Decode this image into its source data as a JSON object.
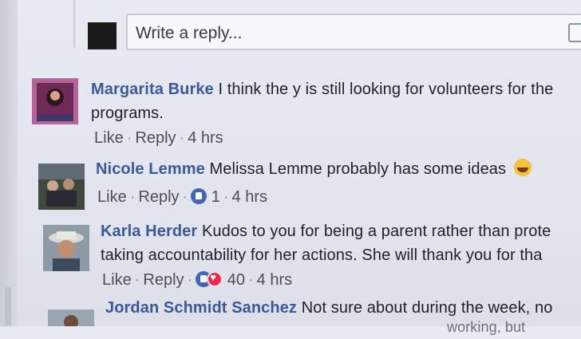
{
  "reply_box": {
    "placeholder": "Write a reply..."
  },
  "comments": [
    {
      "author": "Margarita Burke",
      "text_line1": "I think the y is still looking for volunteers for the",
      "text_line2": "programs.",
      "actions": {
        "like": "Like",
        "reply": "Reply",
        "time": "4 hrs"
      }
    },
    {
      "author": "Nicole Lemme",
      "text_line1": "Melissa Lemme probably has some ideas",
      "emoji": "grinning-face-emoji",
      "actions": {
        "like": "Like",
        "reply": "Reply",
        "reaction_count": "1",
        "time": "4 hrs"
      }
    },
    {
      "author": "Karla Herder",
      "text_line1": "Kudos to you for being a parent rather than prote",
      "text_line2": "taking accountability for her actions. She will thank you for tha",
      "actions": {
        "like": "Like",
        "reply": "Reply",
        "reaction_count": "40",
        "time": "4 hrs"
      }
    },
    {
      "author": "Jordan Schmidt Sanchez",
      "text_line1": "Not sure about during the week, no",
      "text_line2": "working, but"
    }
  ],
  "colors": {
    "author": "#3b5998",
    "like_badge": "#4267b2",
    "love_badge": "#f0284a"
  }
}
